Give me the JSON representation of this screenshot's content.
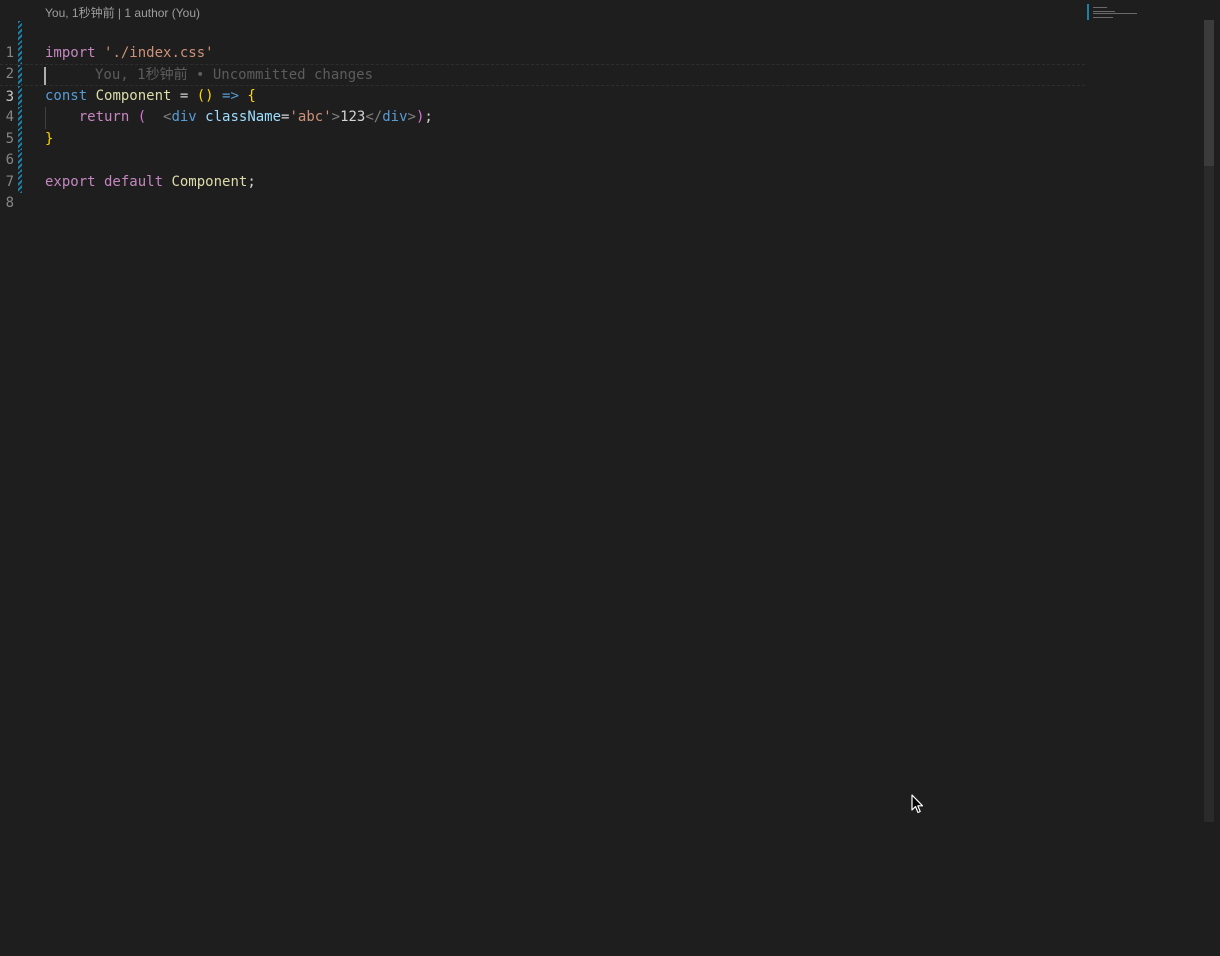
{
  "codelens": {
    "author_time": "You, 1秒钟前",
    "separator": " | ",
    "authors": "1 author (You)"
  },
  "lines": [
    {
      "number": "1"
    },
    {
      "number": "2",
      "tokens": {
        "import": "import",
        "path": "'./index.css'"
      }
    },
    {
      "number": "3",
      "blame": "You, 1秒钟前 • Uncommitted changes"
    },
    {
      "number": "4",
      "tokens": {
        "const": "const",
        "name": "Component",
        "eq": " = ",
        "parens": "()",
        "arrow": " => ",
        "brace": "{"
      }
    },
    {
      "number": "5",
      "tokens": {
        "ret": "return",
        "paren_open": " (",
        "lt": "  <",
        "tag": "div",
        "attr": " className",
        "eq": "=",
        "val": "'abc'",
        "gt": ">",
        "content": "123",
        "close_lt": "</",
        "close_tag": "div",
        "close_gt": ">",
        "paren_close": ")",
        "semi": ";"
      }
    },
    {
      "number": "6",
      "tokens": {
        "brace": "}"
      }
    },
    {
      "number": "7"
    },
    {
      "number": "8",
      "tokens": {
        "export": "export",
        "default": " default",
        "name": " Component",
        "semi": ";"
      }
    }
  ],
  "colors": {
    "background": "#1e1e1e",
    "gutter_change": "#1b81a8",
    "keyword": "#c586c0",
    "declaration": "#569cd6",
    "string": "#ce9178",
    "function": "#dcdcaa"
  },
  "icons": {
    "mouse": "arrow-cursor-icon"
  }
}
